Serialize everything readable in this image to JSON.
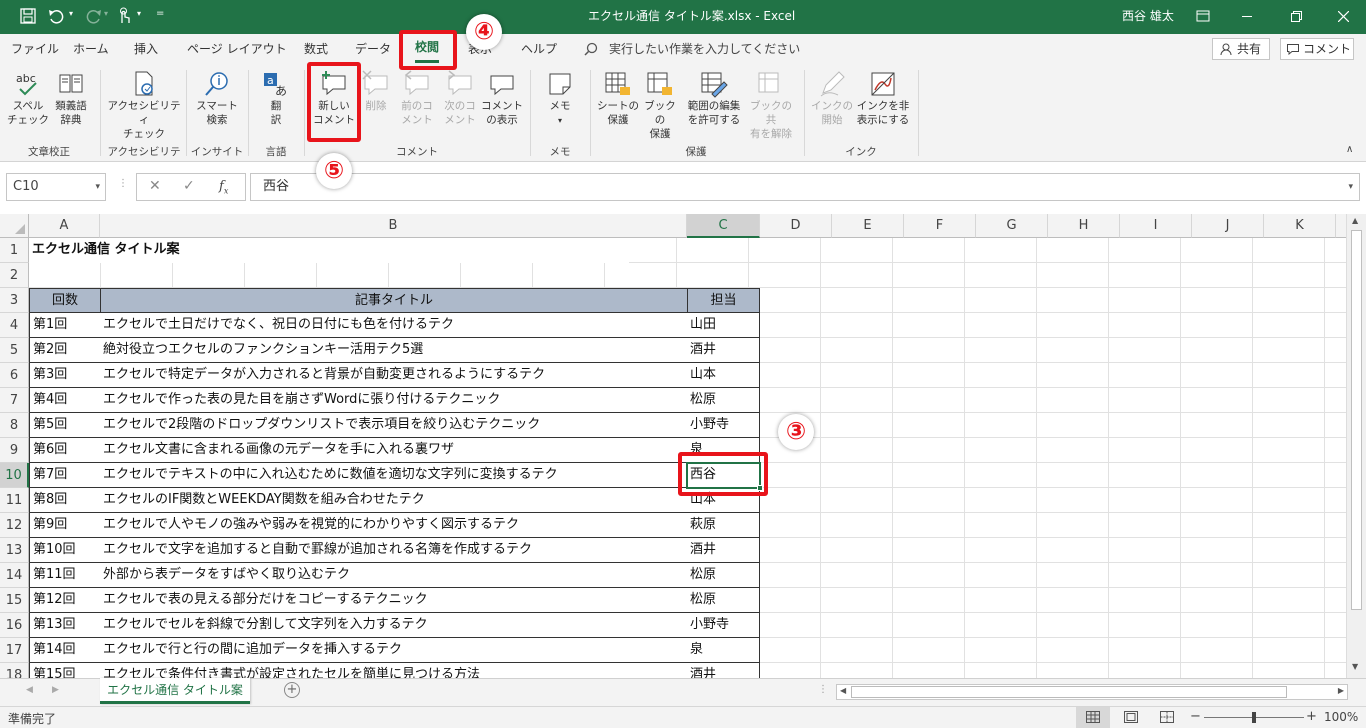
{
  "titlebar": {
    "title": "エクセル通信 タイトル案.xlsx  -  Excel",
    "user": "西谷 雄太",
    "colors": {
      "bar": "#217346"
    }
  },
  "tabs": [
    "ファイル",
    "ホーム",
    "挿入",
    "ページ レイアウト",
    "数式",
    "データ",
    "校閲",
    "表示",
    "ヘルプ"
  ],
  "active_tab": "校閲",
  "tellme": "実行したい作業を入力してください",
  "share_label": "共有",
  "comment_label": "コメント",
  "ribbon": {
    "proof": {
      "spell": "スペル\nチェック",
      "thesaurus": "類義語\n辞典",
      "group": "文章校正"
    },
    "access": {
      "check": "アクセシビリティ\nチェック",
      "group": "アクセシビリティ"
    },
    "insight": {
      "smart": "スマート\n検索",
      "group": "インサイト"
    },
    "lang": {
      "translate": "翻\n訳",
      "group": "言語"
    },
    "comment": {
      "new": "新しい\nコメント",
      "delete": "削除",
      "prev": "前のコ\nメント",
      "next": "次のコ\nメント",
      "show": "コメント\nの表示",
      "group": "コメント"
    },
    "memo": {
      "memo": "メモ",
      "group": "メモ"
    },
    "protect": {
      "sheet": "シートの\n保護",
      "book": "ブックの\n保護",
      "range": "範囲の編集\nを許可する",
      "unshare": "ブックの共\n有を解除",
      "group": "保護"
    },
    "ink": {
      "start": "インクの\n開始",
      "hide": "インクを非\n表示にする",
      "group": "インク"
    }
  },
  "namebox": "C10",
  "formula": "西谷",
  "columns": [
    "A",
    "B",
    "C",
    "D",
    "E",
    "F",
    "G",
    "H",
    "I",
    "J",
    "K"
  ],
  "rows": [
    {
      "n": "1",
      "a": "エクセル通信 タイトル案",
      "b": "",
      "c": ""
    },
    {
      "n": "2",
      "a": "",
      "b": "",
      "c": ""
    },
    {
      "n": "3",
      "a": "回数",
      "b": "記事タイトル",
      "c": "担当"
    },
    {
      "n": "4",
      "a": "第1回",
      "b": "エクセルで土日だけでなく、祝日の日付にも色を付けるテク",
      "c": "山田"
    },
    {
      "n": "5",
      "a": "第2回",
      "b": "絶対役立つエクセルのファンクションキー活用テク5選",
      "c": "酒井"
    },
    {
      "n": "6",
      "a": "第3回",
      "b": "エクセルで特定データが入力されると背景が自動変更されるようにするテク",
      "c": "山本"
    },
    {
      "n": "7",
      "a": "第4回",
      "b": "エクセルで作った表の見た目を崩さずWordに張り付けるテクニック",
      "c": "松原"
    },
    {
      "n": "8",
      "a": "第5回",
      "b": "エクセルで2段階のドロップダウンリストで表示項目を絞り込むテクニック",
      "c": "小野寺"
    },
    {
      "n": "9",
      "a": "第6回",
      "b": "エクセル文書に含まれる画像の元データを手に入れる裏ワザ",
      "c": "泉"
    },
    {
      "n": "10",
      "a": "第7回",
      "b": "エクセルでテキストの中に入れ込むために数値を適切な文字列に変換するテク",
      "c": "西谷"
    },
    {
      "n": "11",
      "a": "第8回",
      "b": "エクセルのIF関数とWEEKDAY関数を組み合わせたテク",
      "c": "山本"
    },
    {
      "n": "12",
      "a": "第9回",
      "b": "エクセルで人やモノの強みや弱みを視覚的にわかりやすく図示するテク",
      "c": "萩原"
    },
    {
      "n": "13",
      "a": "第10回",
      "b": "エクセルで文字を追加すると自動で罫線が追加される名簿を作成するテク",
      "c": "酒井"
    },
    {
      "n": "14",
      "a": "第11回",
      "b": "外部から表データをすばやく取り込むテク",
      "c": "松原"
    },
    {
      "n": "15",
      "a": "第12回",
      "b": "エクセルで表の見える部分だけをコピーするテクニック",
      "c": "松原"
    },
    {
      "n": "16",
      "a": "第13回",
      "b": "エクセルでセルを斜線で分割して文字列を入力するテク",
      "c": "小野寺"
    },
    {
      "n": "17",
      "a": "第14回",
      "b": "エクセルで行と行の間に追加データを挿入するテク",
      "c": "泉"
    },
    {
      "n": "18",
      "a": "第15回",
      "b": "エクセルで条件付き書式が設定されたセルを簡単に見つける方法",
      "c": "酒井"
    }
  ],
  "sheet_tab": "エクセル通信 タイトル案",
  "status": "準備完了",
  "zoom": "100%",
  "callouts": [
    "③",
    "④",
    "⑤"
  ],
  "colors": {
    "accent_red": "#e8141b",
    "header_fill": "#adb9ca",
    "excel_green": "#217346"
  }
}
